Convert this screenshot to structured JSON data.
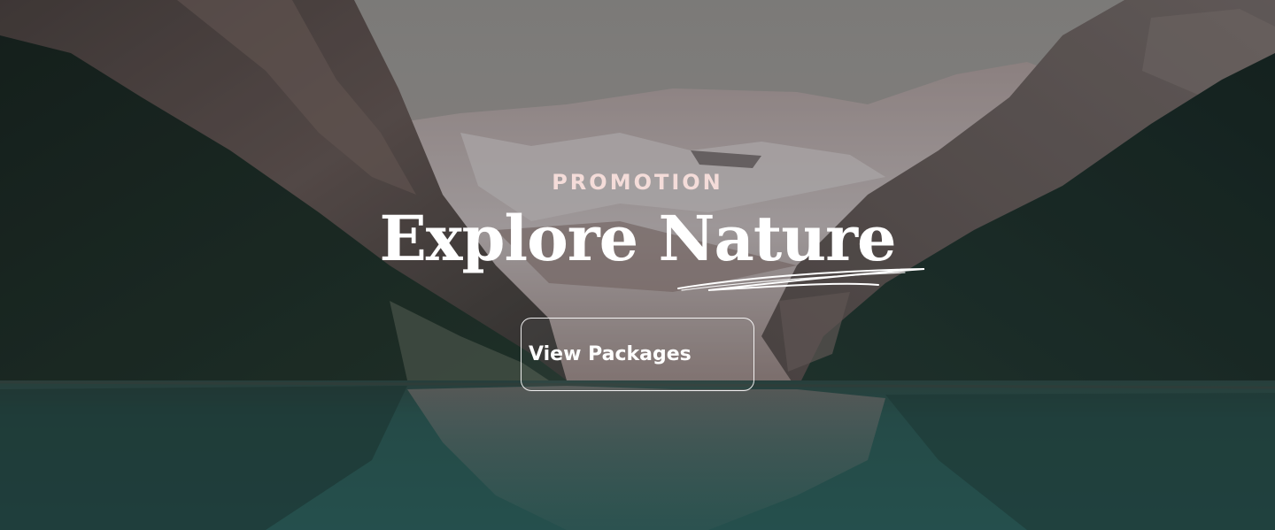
{
  "hero": {
    "eyebrow": "PROMOTION",
    "title": "Explore Nature",
    "cta_label": "View Packages"
  },
  "colors": {
    "eyebrow": "#f4dcd9",
    "title": "#ffffff",
    "lake": "#2d6a66",
    "forest": "#1c3128",
    "sky": "#9e9b97"
  }
}
